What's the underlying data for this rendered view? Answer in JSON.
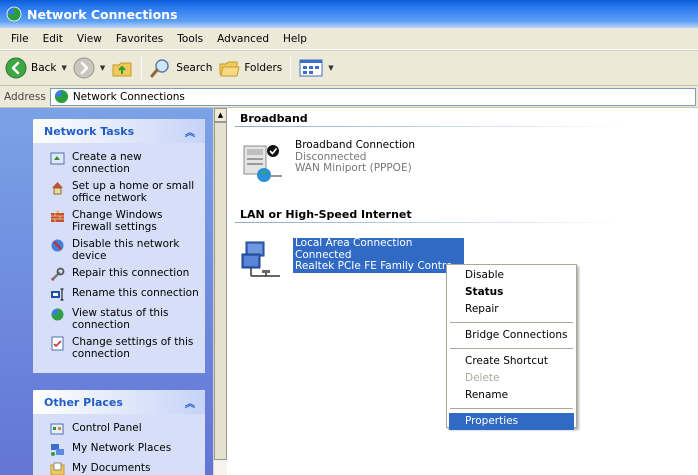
{
  "window": {
    "title": "Network Connections"
  },
  "menubar": {
    "items": [
      "File",
      "Edit",
      "View",
      "Favorites",
      "Tools",
      "Advanced",
      "Help"
    ]
  },
  "toolbar": {
    "back": "Back",
    "search": "Search",
    "folders": "Folders"
  },
  "address": {
    "label": "Address",
    "value": "Network Connections"
  },
  "tasks_panel": {
    "title": "Network Tasks",
    "items": [
      "Create a new connection",
      "Set up a home or small office network",
      "Change Windows Firewall settings",
      "Disable this network device",
      "Repair this connection",
      "Rename this connection",
      "View status of this connection",
      "Change settings of this connection"
    ]
  },
  "places_panel": {
    "title": "Other Places",
    "items": [
      "Control Panel",
      "My Network Places",
      "My Documents"
    ]
  },
  "groups": {
    "broadband": {
      "title": "Broadband",
      "connection": {
        "name": "Broadband Connection",
        "status": "Disconnected",
        "device": "WAN Miniport (PPPOE)"
      }
    },
    "lan": {
      "title": "LAN or High-Speed Internet",
      "connection": {
        "name": "Local Area Connection",
        "status": "Connected",
        "device": "Realtek PCIe FE Family Contro..."
      }
    }
  },
  "context_menu": {
    "items": [
      "Disable",
      "Status",
      "Repair",
      "Bridge Connections",
      "Create Shortcut",
      "Delete",
      "Rename",
      "Properties"
    ]
  },
  "colors": {
    "title_bar": "#2f7cf0",
    "selection": "#316ac5",
    "task_pane": "#6375d6",
    "panel_header_text": "#215dc6"
  }
}
